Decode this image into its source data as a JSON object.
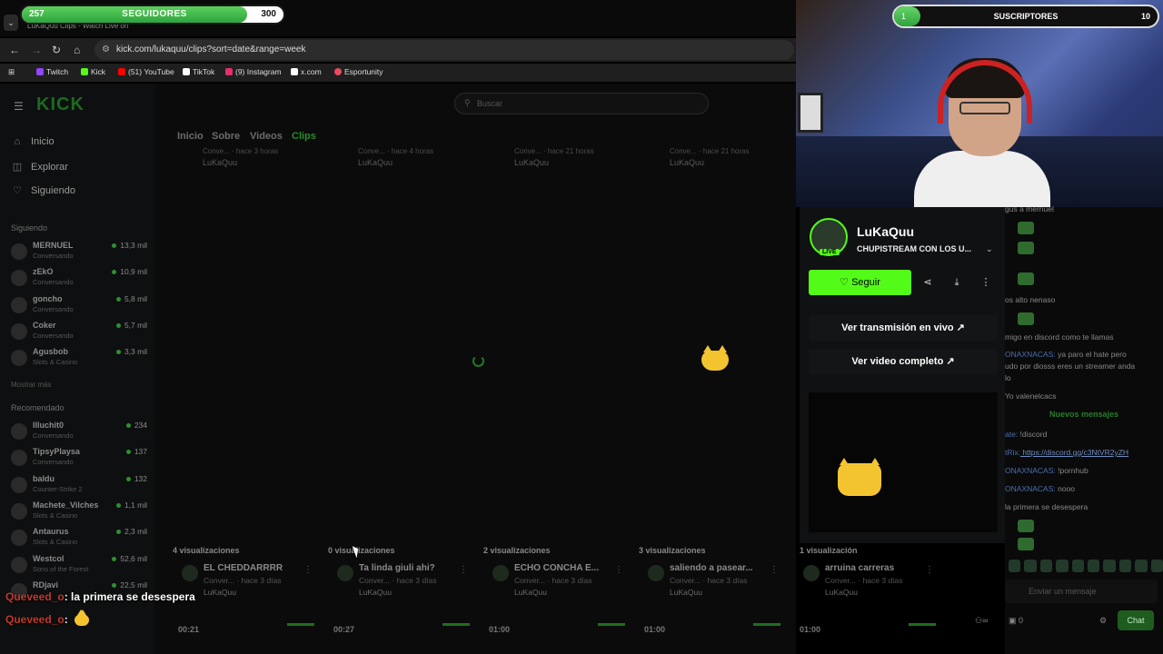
{
  "overlay": {
    "followers": {
      "current": "257",
      "label": "SEGUIDORES",
      "goal": "300",
      "progress": 0.86
    },
    "subs": {
      "current": "1",
      "label": "SUSCRIPTORES",
      "goal": "10",
      "progress": 0.1
    },
    "chat": [
      {
        "user": "Queveed_o",
        "message": ": la primera se desespera"
      },
      {
        "user": "Queveed_o",
        "message": ":"
      }
    ]
  },
  "browser": {
    "tab_title": "LuKaQuu Clips - Watch Live on",
    "url": "kick.com/lukaquu/clips?sort=date&range=week",
    "bookmarks": [
      "Twitch",
      "Kick",
      "(51) YouTube",
      "TikTok",
      "(9) Instagram",
      "x.com",
      "Esportunity"
    ],
    "bookmark_colors": [
      "#9146ff",
      "#53fc18",
      "#ff0000",
      "#ffffff",
      "#e1306c",
      "#ffffff",
      "#e84a5f"
    ]
  },
  "kick": {
    "logo": "KICK",
    "search_placeholder": "Buscar",
    "nav": [
      {
        "label": "Inicio",
        "icon": "home-icon"
      },
      {
        "label": "Explorar",
        "icon": "compass-icon"
      },
      {
        "label": "Siguiendo",
        "icon": "heart-icon"
      }
    ],
    "following_title": "Siguiendo",
    "following": [
      {
        "name": "MERNUEL",
        "sub": "Conversando",
        "count": "13,3 mil"
      },
      {
        "name": "zEkO",
        "sub": "Conversando",
        "count": "10,9 mil"
      },
      {
        "name": "goncho",
        "sub": "Conversando",
        "count": "5,8 mil"
      },
      {
        "name": "Coker",
        "sub": "Conversando",
        "count": "5,7 mil"
      },
      {
        "name": "Agusbob",
        "sub": "Slots & Casino",
        "count": "3,3 mil"
      }
    ],
    "show_more": "Mostrar más",
    "recommended_title": "Recomendado",
    "recommended": [
      {
        "name": "Illuchit0",
        "sub": "Conversando",
        "count": "234"
      },
      {
        "name": "TipsyPlaysa",
        "sub": "Conversando",
        "count": "137"
      },
      {
        "name": "baldu",
        "sub": "Counter-Strike 2",
        "count": "132"
      },
      {
        "name": "Machete_Vilches",
        "sub": "Slots & Casino",
        "count": "1,1 mil"
      },
      {
        "name": "Antaurus",
        "sub": "Slots & Casino",
        "count": "2,3 mil"
      },
      {
        "name": "Westcol",
        "sub": "Sons of the Forest",
        "count": "52,6 mil"
      },
      {
        "name": "RDjavi",
        "sub": "",
        "count": "22,5 mil"
      }
    ],
    "channel_tabs": [
      "Inicio",
      "Sobre",
      "Videos",
      "Clips"
    ],
    "top_clips": [
      {
        "meta": "Conve... · hace 3 horas",
        "author": "LuKaQuu"
      },
      {
        "meta": "Conve... · hace 4 horas",
        "author": "LuKaQuu"
      },
      {
        "meta": "Conve... · hace 21 horas",
        "author": "LuKaQuu"
      },
      {
        "meta": "Conve... · hace 21 horas",
        "author": "LuKaQuu"
      }
    ],
    "clips": [
      {
        "views": "4 visualizaciones",
        "title": "EL CHEDDARRRR",
        "meta": "Conver... · hace 3 días",
        "author": "LuKaQuu",
        "duration": "00:21"
      },
      {
        "views": "0 visualizaciones",
        "title": "Ta linda giuli ahi?",
        "meta": "Conver... · hace 3 días",
        "author": "LuKaQuu",
        "duration": "00:27"
      },
      {
        "views": "2 visualizaciones",
        "title": "ECHO CONCHA E...",
        "meta": "Conver... · hace 3 días",
        "author": "LuKaQuu",
        "duration": "01:00"
      },
      {
        "views": "3 visualizaciones",
        "title": "saliendo a pasear...",
        "meta": "Conver... · hace 3 días",
        "author": "LuKaQuu",
        "duration": "01:00"
      },
      {
        "views": "1 visualización",
        "title": "arruina carreras",
        "meta": "Conver... · hace 3 días",
        "author": "LuKaQuu",
        "duration": "01:00"
      }
    ]
  },
  "card": {
    "name": "LuKaQuu",
    "live": "LIVE",
    "title": "CHUPISTREAM CON LOS U...",
    "follow": "Seguir",
    "watch_live": "Ver transmisión en vivo",
    "watch_full": "Ver video completo"
  },
  "chat_panel": {
    "lines": [
      {
        "nick": "",
        "text": "gus a mernuel"
      },
      {
        "nick": "",
        "text": "os alto nenaso"
      },
      {
        "nick": "",
        "text": "migo en discord como te llamas"
      },
      {
        "nick": "ONAXNACAS:",
        "text": " ya paro el hate pero"
      },
      {
        "nick": "",
        "text": "udo por diosss eres un streamer anda"
      },
      {
        "nick": "",
        "text": "lo"
      },
      {
        "nick": "",
        "text": "Yo valenelcacs"
      }
    ],
    "new_messages": "Nuevos mensajes",
    "after": [
      {
        "nick": "ate:",
        "text": " !discord"
      },
      {
        "nick": "tRix:",
        "text": " https://discord.gg/c3NtVR2yZH",
        "link": true
      },
      {
        "nick": "ONAXNACAS:",
        "text": " !pornhub"
      },
      {
        "nick": "ONAXNACAS:",
        "text": " nooo"
      },
      {
        "nick": "",
        "text": "la primera se desespera"
      }
    ],
    "input_placeholder": "Enviar un mensaje",
    "viewers": "0",
    "send": "Chat"
  }
}
